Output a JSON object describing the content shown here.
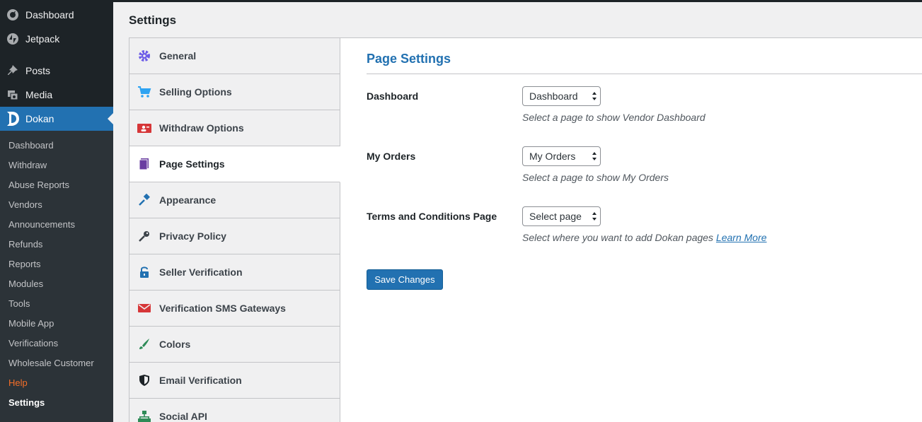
{
  "admin_menu": {
    "items": [
      {
        "label": "Dashboard",
        "icon": "dashboard-icon"
      },
      {
        "label": "Jetpack",
        "icon": "jetpack-icon"
      },
      {
        "label": "Posts",
        "icon": "pin-icon"
      },
      {
        "label": "Media",
        "icon": "media-icon"
      },
      {
        "label": "Dokan",
        "icon": "dokan-logo-icon"
      }
    ],
    "submenu": [
      "Dashboard",
      "Withdraw",
      "Abuse Reports",
      "Vendors",
      "Announcements",
      "Refunds",
      "Reports",
      "Modules",
      "Tools",
      "Mobile App",
      "Verifications",
      "Wholesale Customer",
      "Help",
      "Settings"
    ]
  },
  "page": {
    "title": "Settings"
  },
  "settings_nav": [
    {
      "label": "General",
      "icon": "gear-icon",
      "color": "#6c5ce7"
    },
    {
      "label": "Selling Options",
      "icon": "cart-icon",
      "color": "#2ea3f2"
    },
    {
      "label": "Withdraw Options",
      "icon": "withdraw-icon",
      "color": "#d63638"
    },
    {
      "label": "Page Settings",
      "icon": "book-icon",
      "color": "#6a3ea1"
    },
    {
      "label": "Appearance",
      "icon": "brush-icon",
      "color": "#2271b1"
    },
    {
      "label": "Privacy Policy",
      "icon": "key-icon",
      "color": "#3c434a"
    },
    {
      "label": "Seller Verification",
      "icon": "lock-icon",
      "color": "#2271b1"
    },
    {
      "label": "Verification SMS Gateways",
      "icon": "envelope-icon",
      "color": "#d63638"
    },
    {
      "label": "Colors",
      "icon": "paint-brush-icon",
      "color": "#2e8b57"
    },
    {
      "label": "Email Verification",
      "icon": "shield-icon",
      "color": "#1d2327"
    },
    {
      "label": "Social API",
      "icon": "sitemap-icon",
      "color": "#2e8b57"
    }
  ],
  "panel": {
    "title": "Page Settings",
    "fields": [
      {
        "label": "Dashboard",
        "value": "Dashboard",
        "description": "Select a page to show Vendor Dashboard"
      },
      {
        "label": "My Orders",
        "value": "My Orders",
        "description": "Select a page to show My Orders"
      },
      {
        "label": "Terms and Conditions Page",
        "value": "Select page",
        "description": "Select where you want to add Dokan pages",
        "link": "Learn More"
      }
    ],
    "save_label": "Save Changes"
  }
}
